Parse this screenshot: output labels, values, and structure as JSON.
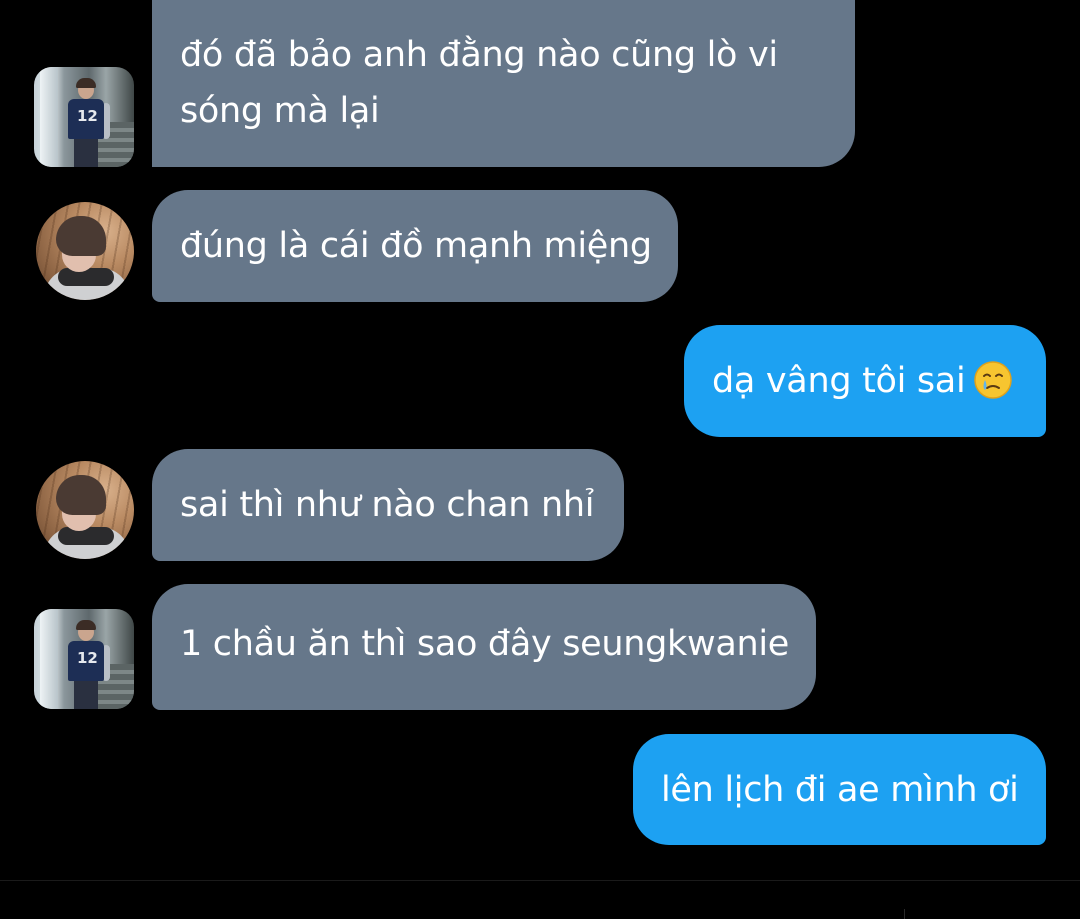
{
  "messages": [
    {
      "side": "in",
      "avatar": "photo-square",
      "text_line1": "đó đã bảo anh đằng nào cũng lò vi",
      "text_line2": "sóng mà lại"
    },
    {
      "side": "in",
      "avatar": "photo-circle",
      "text": "đúng là cái đồ mạnh miệng"
    },
    {
      "side": "out",
      "text": "dạ vâng tôi sai",
      "emoji": "face-holding-back-tears-icon"
    },
    {
      "side": "in",
      "avatar": "photo-circle",
      "text": "sai thì như nào chan nhỉ"
    },
    {
      "side": "in",
      "avatar": "photo-square",
      "text": "1 chầu ăn thì sao đây seungkwanie"
    },
    {
      "side": "out",
      "text": "lên lịch đi ae mình ơi"
    }
  ],
  "colors": {
    "background": "#000000",
    "incoming_bubble": "#66778a",
    "outgoing_bubble": "#1da1f2",
    "text": "#ffffff"
  }
}
